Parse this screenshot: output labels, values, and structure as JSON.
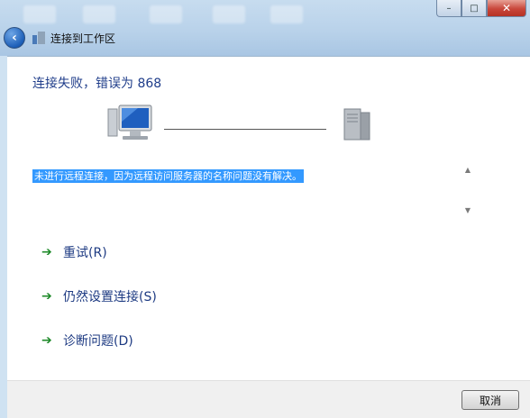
{
  "window": {
    "title": "连接到工作区",
    "controls": {
      "minimize": "–",
      "maximize": "□",
      "close": "✕"
    }
  },
  "content": {
    "heading": "连接失败，错误为 868",
    "message": "未进行远程连接，因为远程访问服务器的名称问题没有解决。",
    "options": [
      {
        "label": "重试(R)"
      },
      {
        "label": "仍然设置连接(S)"
      },
      {
        "label": "诊断问题(D)"
      }
    ]
  },
  "footer": {
    "cancel_label": "取消"
  },
  "colors": {
    "heading": "#1f3d8a",
    "selection": "#3399ff",
    "arrow": "#1f8a2a"
  }
}
